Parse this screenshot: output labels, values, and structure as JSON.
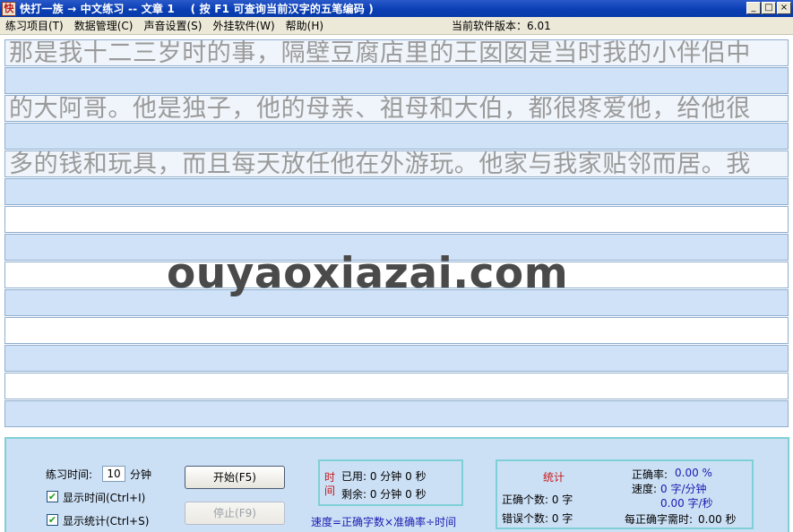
{
  "window": {
    "icon_glyph": "快",
    "title": "快打一族 → 中文练习 -- 文章 1    ( 按 F1 可查询当前汉字的五笔编码 )",
    "controls": [
      "_",
      "□",
      "×"
    ]
  },
  "menu": {
    "items": [
      "练习项目(T)",
      "数据管理(C)",
      "声音设置(S)",
      "外挂软件(W)",
      "帮助(H)"
    ],
    "version": "当前软件版本：6.01"
  },
  "practice": {
    "lines": [
      "那是我十二三岁时的事，隔壁豆腐店里的王囡囡是当时我的小伴侣中",
      "的大阿哥。他是独子，他的母亲、祖母和大伯，都很疼爱他，给他很",
      "多的钱和玩具，而且每天放任他在外游玩。他家与我家贴邻而居。我"
    ]
  },
  "watermark": "ouyaoxiazai.com",
  "controls": {
    "time_label": "练习时间:",
    "time_value": "10",
    "time_unit": "分钟",
    "show_time_label": "显示时间(Ctrl+I)",
    "show_time_checked": true,
    "show_stats_label": "显示统计(Ctrl+S)",
    "show_stats_checked": true,
    "start_button": "开始(F5)",
    "stop_button": "停止(F9)"
  },
  "timer": {
    "vertical_label_1": "时",
    "vertical_label_2": "间",
    "used": "已用: 0 分钟  0 秒",
    "remaining": "剩余: 0 分钟  0 秒",
    "formula": "速度=正确字数×准确率÷时间"
  },
  "stats": {
    "title": "统计",
    "correct_count": "正确个数: 0 字",
    "error_count": "错误个数: 0 字",
    "accuracy_label": "正确率:",
    "accuracy_value": "0.00 %",
    "speed_label": "速度:",
    "speed_per_min": "0 字/分钟",
    "speed_per_sec": "0.00 字/秒",
    "time_per_char_label": "每正确字需时:",
    "time_per_char_value": "0.00 秒"
  }
}
